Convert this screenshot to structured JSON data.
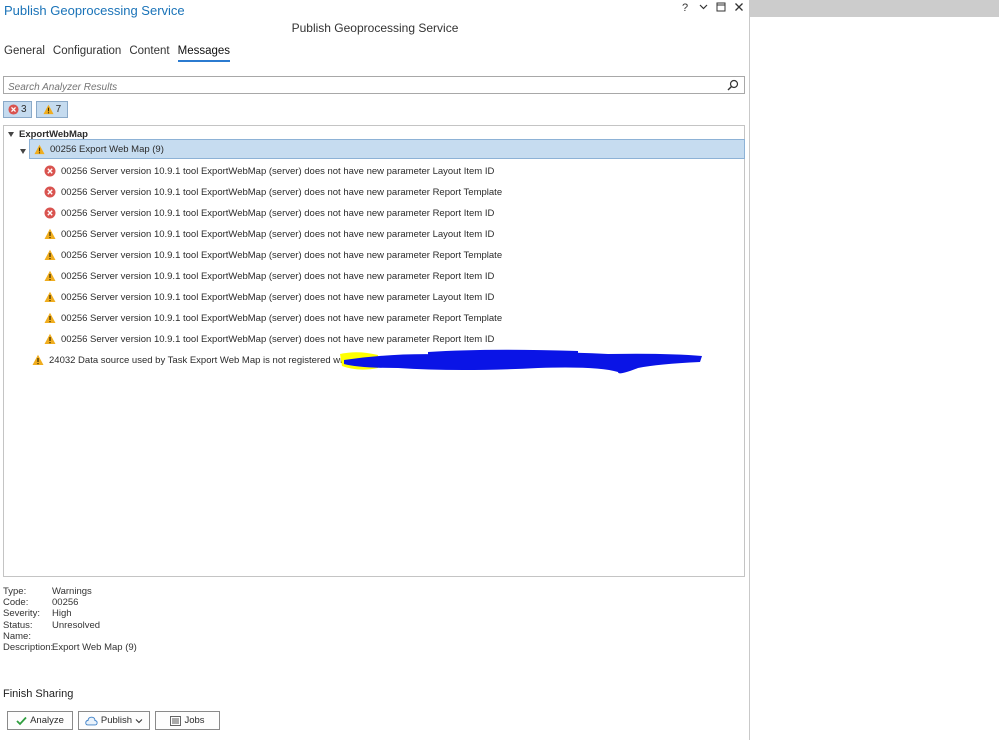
{
  "pane": {
    "title": "Publish Geoprocessing Service",
    "heading": "Publish Geoprocessing Service",
    "controls": {
      "help": "?",
      "menu": "⌄",
      "pin": "🗕",
      "close": "✕"
    }
  },
  "tabs": [
    {
      "label": "General",
      "active": false
    },
    {
      "label": "Configuration",
      "active": false
    },
    {
      "label": "Content",
      "active": false
    },
    {
      "label": "Messages",
      "active": true
    }
  ],
  "search": {
    "placeholder": "Search Analyzer Results",
    "value": ""
  },
  "filters": {
    "errors": "3",
    "warnings": "7"
  },
  "tree": {
    "root": "ExportWebMap",
    "group": "00256 Export Web Map (9)",
    "items": [
      {
        "icon": "error",
        "text": "00256 Server version 10.9.1 tool ExportWebMap (server) does not have new parameter Layout Item ID"
      },
      {
        "icon": "error",
        "text": "00256 Server version 10.9.1 tool ExportWebMap (server) does not have new parameter Report Template"
      },
      {
        "icon": "error",
        "text": "00256 Server version 10.9.1 tool ExportWebMap (server) does not have new parameter Report Item ID"
      },
      {
        "icon": "warning",
        "text": "00256 Server version 10.9.1 tool ExportWebMap (server) does not have new parameter Layout Item ID"
      },
      {
        "icon": "warning",
        "text": "00256 Server version 10.9.1 tool ExportWebMap (server) does not have new parameter Report Template"
      },
      {
        "icon": "warning",
        "text": "00256 Server version 10.9.1 tool ExportWebMap (server) does not have new parameter Report Item ID"
      },
      {
        "icon": "warning",
        "text": "00256 Server version 10.9.1 tool ExportWebMap (server) does not have new parameter Layout Item ID"
      },
      {
        "icon": "warning",
        "text": "00256 Server version 10.9.1 tool ExportWebMap (server) does not have new parameter Report Template"
      },
      {
        "icon": "warning",
        "text": "00256 Server version 10.9.1 tool ExportWebMap (server) does not have new parameter Report Item ID"
      }
    ],
    "last": "24032 Data source used by Task Export Web Map is not registered with the"
  },
  "details": [
    {
      "key": "Type:",
      "value": "Warnings"
    },
    {
      "key": "Code:",
      "value": "00256"
    },
    {
      "key": "Severity:",
      "value": "High"
    },
    {
      "key": "Status:",
      "value": "Unresolved"
    },
    {
      "key": "Name:",
      "value": ""
    },
    {
      "key": "Description:",
      "value": "Export Web Map (9)"
    }
  ],
  "finish": {
    "title": "Finish Sharing"
  },
  "buttons": {
    "analyze": "Analyze",
    "publish": "Publish",
    "jobs": "Jobs"
  },
  "colors": {
    "accent": "#1a73b8",
    "selection": "#c6dcf0",
    "error": "#d9534f",
    "warning": "#f0ad1e"
  }
}
